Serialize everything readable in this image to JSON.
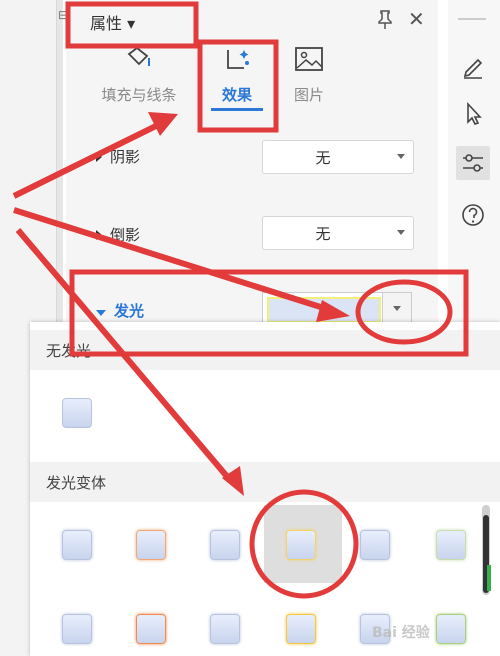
{
  "header": {
    "title": "属性 ▾"
  },
  "tabs": [
    {
      "label": "填充与线条",
      "icon": "fill-line-icon",
      "active": false
    },
    {
      "label": "效果",
      "icon": "effect-icon",
      "active": true
    },
    {
      "label": "图片",
      "icon": "picture-icon",
      "active": false
    }
  ],
  "rows": {
    "shadow": {
      "label": "阴影",
      "value": "无"
    },
    "reflection": {
      "label": "倒影",
      "value": "无"
    },
    "glow": {
      "label": "发光"
    }
  },
  "popup": {
    "section_none": "无发光",
    "section_variants": "发光变体",
    "row1_colors": [
      "#b9c4dc",
      "#f0a878",
      "#b9c4dc",
      "#f5d270",
      "#b9c4dc",
      "#c9dcae"
    ],
    "row2_colors": [
      "#b9c4dc",
      "#f08a50",
      "#b9c4dc",
      "#f5c840",
      "#b9c4dc",
      "#a8cf80"
    ]
  },
  "watermark": "Bai 经验",
  "colors": {
    "accent": "#2b78d6",
    "annotation": "#e23b3b"
  }
}
